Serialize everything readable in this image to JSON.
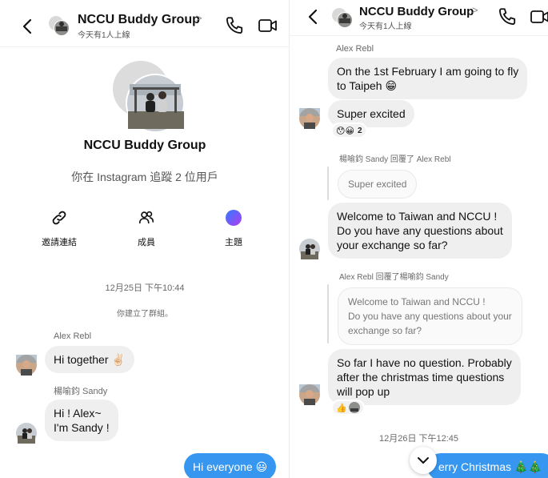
{
  "left": {
    "header": {
      "title": "NCCU Buddy Group",
      "chevron": ">",
      "subtitle": "今天有1人上線"
    },
    "profile": {
      "name": "NCCU Buddy Group",
      "follow_info": "你在 Instagram 追蹤 2 位用戶"
    },
    "actions": [
      {
        "label": "邀請連結",
        "icon": "link-icon"
      },
      {
        "label": "成員",
        "icon": "members-icon"
      },
      {
        "label": "主題",
        "icon": "theme-icon"
      }
    ],
    "timestamp": "12月25日 下午10:44",
    "system_message": "你建立了群組。",
    "messages": [
      {
        "sender": "Alex Rebl",
        "text": "Hi together ✌🏻"
      },
      {
        "sender": "楊喻鈞 Sandy",
        "line1": "Hi ! Alex~",
        "line2": "I'm Sandy !"
      },
      {
        "text": "Hi everyone 😃"
      }
    ]
  },
  "right": {
    "header": {
      "title": "NCCU Buddy Group",
      "chevron": ">",
      "subtitle": "今天有1人上線"
    },
    "alex_sender": "Alex Rebl",
    "msg1_line1": "On the 1st February I am going to fly",
    "msg1_line2": "to Taipeh 😁",
    "msg2": "Super excited",
    "reaction1": {
      "emojis": "😯😀",
      "count": "2"
    },
    "reply1_note": "楊喻鈞 Sandy 回覆了 Alex Rebl",
    "reply1_quote": "Super excited",
    "msg3_lines": [
      "Welcome to Taiwan and NCCU !",
      "Do you have any questions about",
      "your exchange so far?"
    ],
    "reply2_note": "Alex Rebl 回覆了楊喻鈞 Sandy",
    "reply2_quote_lines": [
      "Welcome to Taiwan and NCCU !",
      "Do you have any questions about  your",
      "exchange so far?"
    ],
    "msg4_lines": [
      "So far I have no question. Probably",
      "after the christmas time questions",
      "will pop up"
    ],
    "reaction2": {
      "emojis": "👍"
    },
    "timestamp": "12月26日 下午12:45",
    "outgoing_partial": "erry Christmas 🎄🎄"
  },
  "colors": {
    "accent": "#3797f0",
    "bubble_in": "#efefef",
    "text_secondary": "#6a6a6a"
  }
}
